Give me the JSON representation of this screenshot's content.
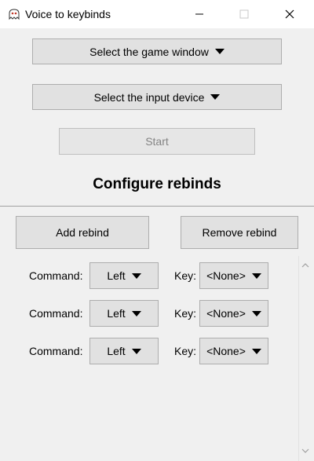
{
  "window": {
    "title": "Voice to keybinds",
    "app_icon": "ghost-icon"
  },
  "controls": {
    "game_window_label": "Select the game window",
    "input_device_label": "Select the input device",
    "start_label": "Start",
    "start_enabled": false
  },
  "section": {
    "heading": "Configure rebinds",
    "add_label": "Add rebind",
    "remove_label": "Remove rebind"
  },
  "rebinds": [
    {
      "command_label": "Command:",
      "command_value": "Left",
      "key_label": "Key:",
      "key_value": "<None>"
    },
    {
      "command_label": "Command:",
      "command_value": "Left",
      "key_label": "Key:",
      "key_value": "<None>"
    },
    {
      "command_label": "Command:",
      "command_value": "Left",
      "key_label": "Key:",
      "key_value": "<None>"
    }
  ],
  "colors": {
    "background": "#f0f0f0",
    "button": "#e1e1e1",
    "button_border": "#adadad",
    "disabled_text": "#838383"
  }
}
